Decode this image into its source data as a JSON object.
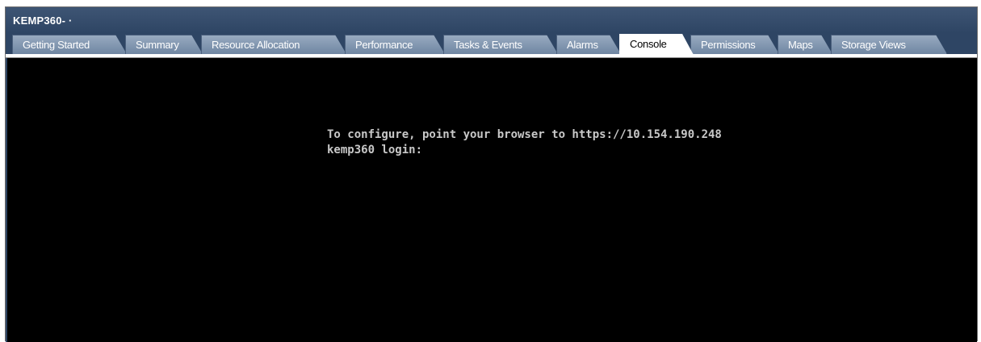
{
  "window": {
    "title": "KEMP360- ·"
  },
  "tabs": [
    {
      "label": "Getting Started",
      "active": false
    },
    {
      "label": "Summary",
      "active": false
    },
    {
      "label": "Resource Allocation",
      "active": false
    },
    {
      "label": "Performance",
      "active": false
    },
    {
      "label": "Tasks & Events",
      "active": false
    },
    {
      "label": "Alarms",
      "active": false
    },
    {
      "label": "Console",
      "active": true
    },
    {
      "label": "Permissions",
      "active": false
    },
    {
      "label": "Maps",
      "active": false
    },
    {
      "label": "Storage Views",
      "active": false
    }
  ],
  "console": {
    "lines": [
      "To configure, point your browser to https://10.154.190.248",
      "kemp360 login:"
    ]
  },
  "colors": {
    "title_bar": "#2e4564",
    "tab_inactive": "#8196b2",
    "tab_active": "#ffffff",
    "console_bg": "#000000",
    "console_text": "#c8c8c8"
  }
}
